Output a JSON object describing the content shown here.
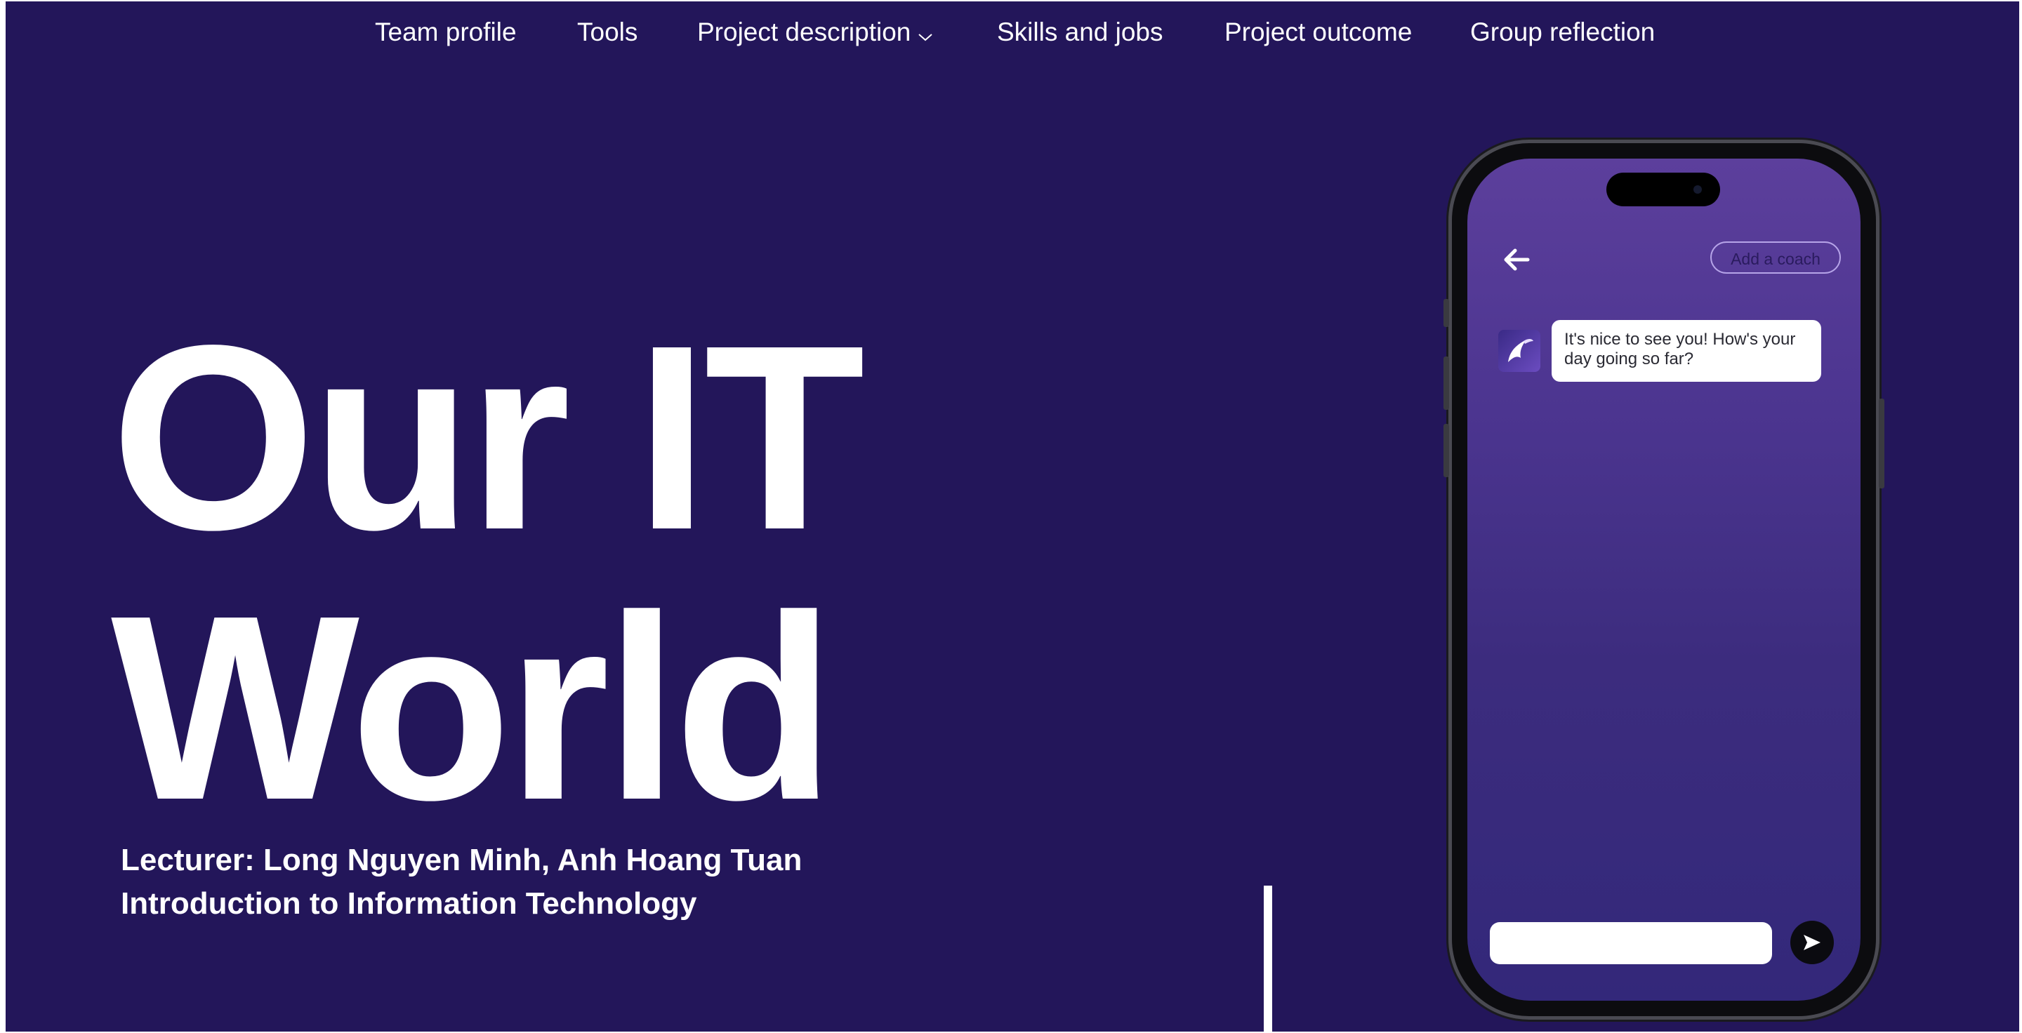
{
  "nav": {
    "items": [
      {
        "label": "Team profile"
      },
      {
        "label": "Tools"
      },
      {
        "label": "Project description",
        "has_dropdown": true
      },
      {
        "label": "Skills and jobs"
      },
      {
        "label": "Project outcome"
      },
      {
        "label": "Group reflection"
      }
    ]
  },
  "hero": {
    "title_line1": "Our IT",
    "title_line2": "World",
    "lecturer": "Lecturer: Long Nguyen Minh, Anh Hoang Tuan",
    "course": "Introduction to Information Technology"
  },
  "phone": {
    "coach_button": "Add a coach",
    "chat_message": "It's nice to see you! How's your day going so far?",
    "input_value": "",
    "icons": {
      "back": "arrow-left-icon",
      "send": "send-icon",
      "avatar": "coach-avatar-icon"
    }
  },
  "colors": {
    "background": "#23165a",
    "text": "#ffffff",
    "screen_top": "#5c3f9c",
    "screen_bottom": "#33287a"
  }
}
